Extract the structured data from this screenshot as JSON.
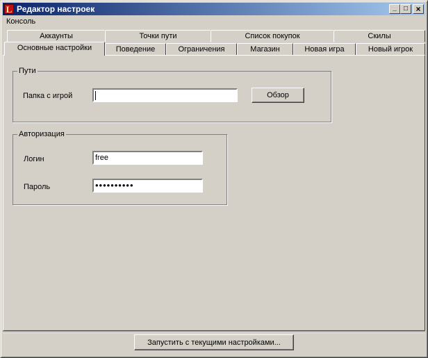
{
  "window": {
    "title": "Редактор настроек",
    "icon_letter": "L",
    "minimize_glyph": "_",
    "maximize_glyph": "□",
    "close_glyph": "×"
  },
  "menu": {
    "items": [
      "Консоль"
    ]
  },
  "tabs": {
    "row1": [
      "Аккаунты",
      "Точки пути",
      "Список покупок",
      "Скилы"
    ],
    "row2": [
      "Основные настройки",
      "Поведение",
      "Ограничения",
      "Магазин",
      "Новая игра",
      "Новый игрок"
    ],
    "active": "Основные настройки"
  },
  "paths_group": {
    "legend": "Пути",
    "game_folder_label": "Папка с игрой",
    "game_folder_value": "",
    "browse_button": "Обзор"
  },
  "auth_group": {
    "legend": "Авторизация",
    "login_label": "Логин",
    "login_value": "free",
    "password_label": "Пароль",
    "password_value": "••••••••••"
  },
  "footer": {
    "run_button": "Запустить с текущими настройками..."
  }
}
